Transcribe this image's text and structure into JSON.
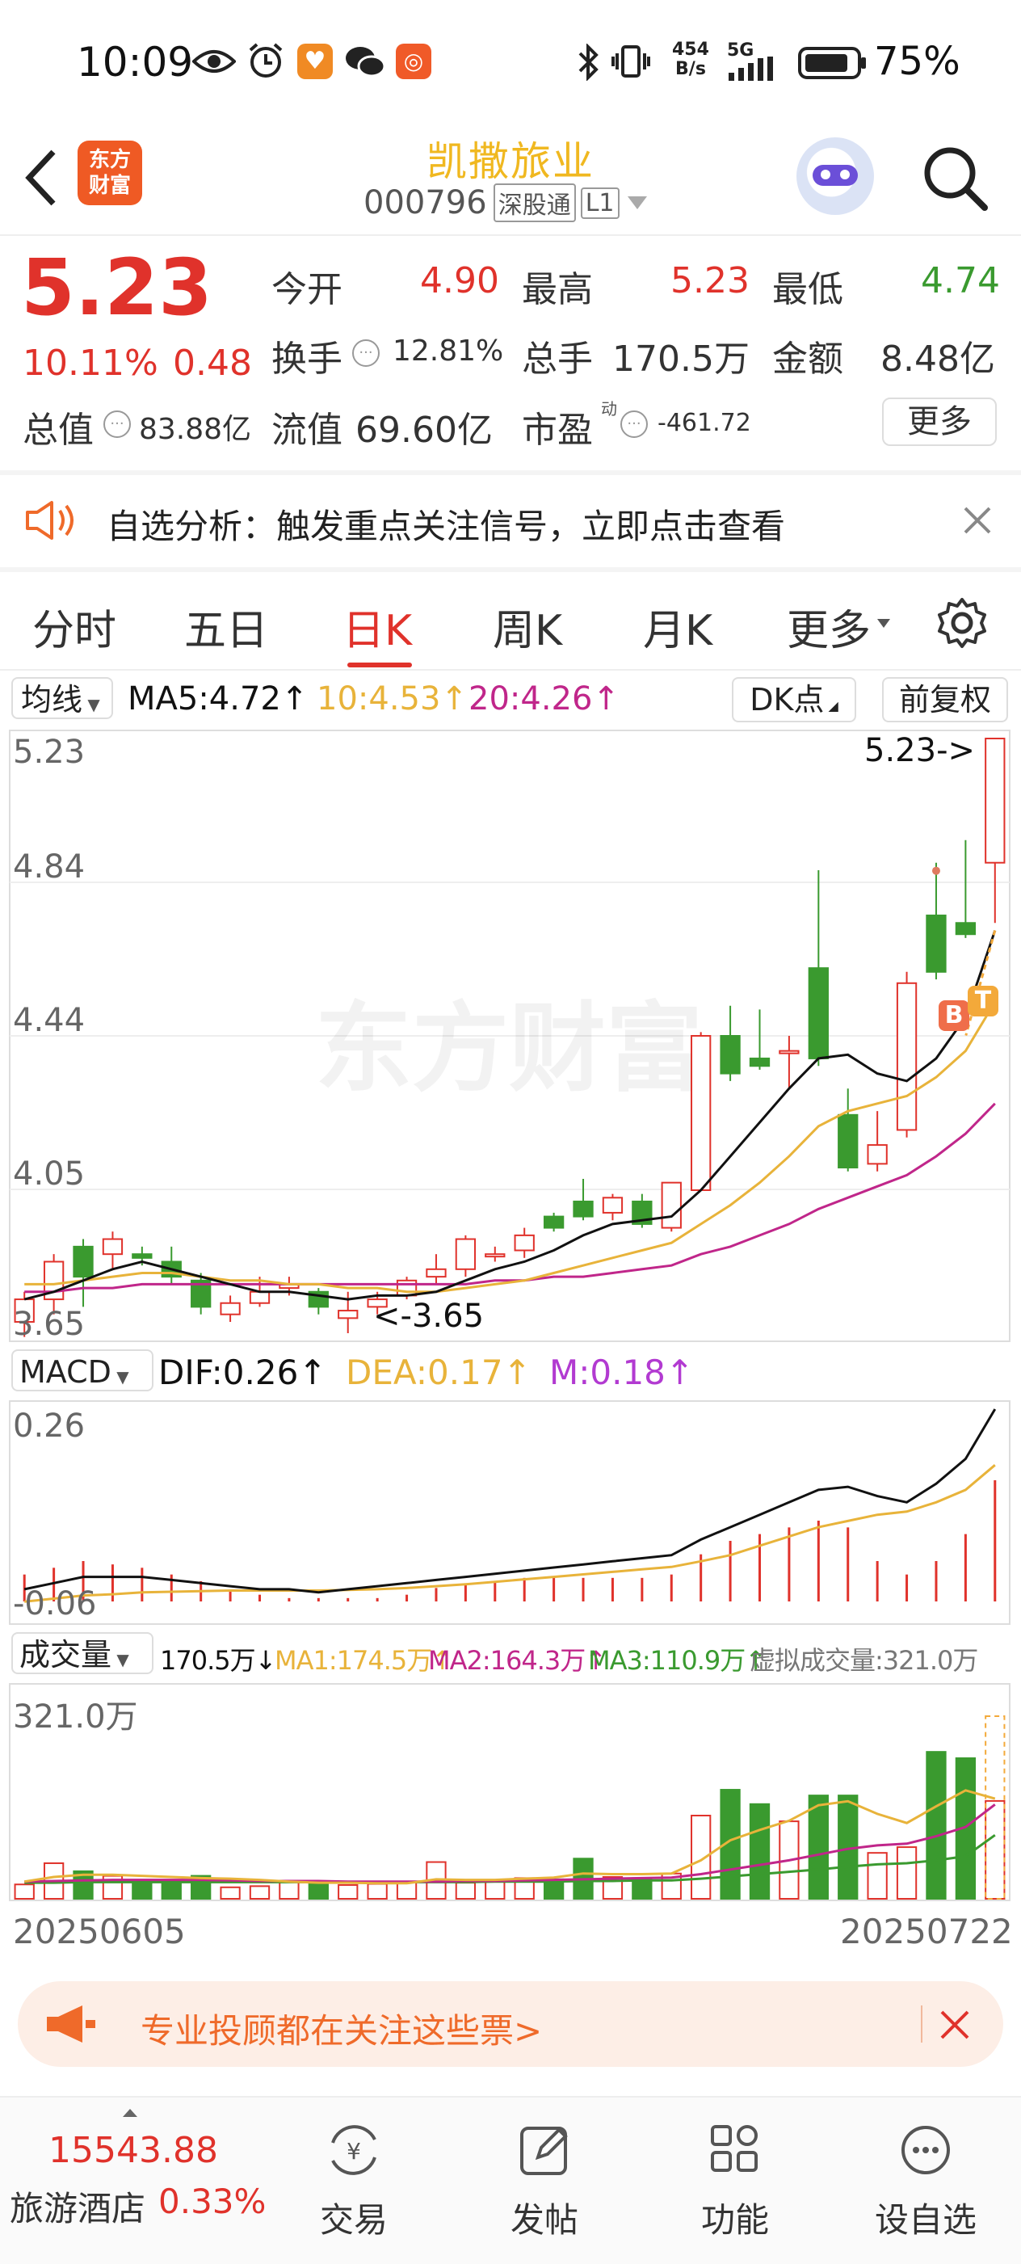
{
  "status_bar": {
    "time": "10:09",
    "net_speed_top": "454",
    "net_speed_bottom": "B/s",
    "signal": "5G",
    "battery": "75%"
  },
  "header": {
    "back_icon": "chevron-left-icon",
    "logo_line1": "东方",
    "logo_line2": "财富",
    "stock_name": "凯撒旅业",
    "stock_code": "000796",
    "tag_connect": "深股通",
    "tag_level": "L1",
    "search_icon": "search-icon"
  },
  "quote": {
    "price": "5.23",
    "change_pct": "10.11%",
    "change_amt": "0.48",
    "open_label": "今开",
    "open": "4.90",
    "high_label": "最高",
    "high": "5.23",
    "low_label": "最低",
    "low": "4.74",
    "turnover_label": "换手",
    "turnover": "12.81%",
    "volume_label": "总手",
    "volume": "170.5万",
    "amount_label": "金额",
    "amount": "8.48亿",
    "mktcap_label": "总值",
    "mktcap": "83.88亿",
    "float_label": "流值",
    "float": "69.60亿",
    "pe_label": "市盈",
    "pe_sup": "动",
    "pe": "-461.72",
    "more_button": "更多"
  },
  "notice": {
    "text": "自选分析：触发重点关注信号，立即点击查看"
  },
  "tabs": [
    {
      "label": "分时",
      "active": false
    },
    {
      "label": "五日",
      "active": false
    },
    {
      "label": "日K",
      "active": true
    },
    {
      "label": "周K",
      "active": false
    },
    {
      "label": "月K",
      "active": false
    },
    {
      "label": "更多",
      "active": false
    }
  ],
  "ma_bar": {
    "selector": "均线",
    "ma5": "MA5:4.72↑",
    "ma10": "10:4.53↑",
    "ma20": "20:4.26↑",
    "dk_button": "DK点",
    "adjust_button": "前复权"
  },
  "kline_axis": {
    "y_labels": [
      "5.23",
      "4.84",
      "4.44",
      "4.05",
      "3.65"
    ],
    "max_marker": "5.23->",
    "min_marker": "<-3.65",
    "watermark": "东方财富",
    "badge_b": "B",
    "badge_t": "T"
  },
  "macd_bar": {
    "selector": "MACD",
    "dif": "DIF:0.26↑",
    "dea": "DEA:0.17↑",
    "m": "M:0.18↑",
    "y_top": "0.26",
    "y_bottom": "-0.06"
  },
  "vol_bar": {
    "selector": "成交量",
    "vol": "170.5万↓",
    "ma1": "MA1:174.5万↑",
    "ma2": "MA2:164.3万↑",
    "ma3": "MA3:110.9万↑",
    "virtual": "虚拟成交量:321.0万",
    "y_top": "321.0万"
  },
  "date_axis": {
    "start": "20250605",
    "end": "20250722"
  },
  "promo": {
    "text": "专业投顾都在关注这些票>"
  },
  "bottom_bar": {
    "index_value": "15543.88",
    "index_name": "旅游酒店",
    "index_change": "0.33%",
    "buttons": [
      "交易",
      "发帖",
      "功能",
      "设自选"
    ]
  },
  "colors": {
    "up": "#e0322b",
    "down": "#3a9a2f",
    "ma5": "#111111",
    "ma10": "#e8b33a",
    "ma20": "#c0268a"
  },
  "chart_data": {
    "type": "candlestick",
    "ylim": [
      3.65,
      5.23
    ],
    "candles": [
      {
        "o": 3.68,
        "c": 3.74,
        "h": 3.76,
        "l": 3.64
      },
      {
        "o": 3.74,
        "c": 3.84,
        "h": 3.86,
        "l": 3.7
      },
      {
        "o": 3.88,
        "c": 3.8,
        "h": 3.9,
        "l": 3.72
      },
      {
        "o": 3.86,
        "c": 3.9,
        "h": 3.92,
        "l": 3.82
      },
      {
        "o": 3.86,
        "c": 3.85,
        "h": 3.88,
        "l": 3.83
      },
      {
        "o": 3.84,
        "c": 3.8,
        "h": 3.88,
        "l": 3.78
      },
      {
        "o": 3.79,
        "c": 3.72,
        "h": 3.81,
        "l": 3.7
      },
      {
        "o": 3.7,
        "c": 3.73,
        "h": 3.75,
        "l": 3.68
      },
      {
        "o": 3.73,
        "c": 3.76,
        "h": 3.8,
        "l": 3.72
      },
      {
        "o": 3.77,
        "c": 3.78,
        "h": 3.8,
        "l": 3.75
      },
      {
        "o": 3.76,
        "c": 3.72,
        "h": 3.77,
        "l": 3.7
      },
      {
        "o": 3.69,
        "c": 3.71,
        "h": 3.76,
        "l": 3.65
      },
      {
        "o": 3.72,
        "c": 3.74,
        "h": 3.76,
        "l": 3.7
      },
      {
        "o": 3.75,
        "c": 3.79,
        "h": 3.8,
        "l": 3.74
      },
      {
        "o": 3.8,
        "c": 3.82,
        "h": 3.86,
        "l": 3.78
      },
      {
        "o": 3.82,
        "c": 3.9,
        "h": 3.91,
        "l": 3.8
      },
      {
        "o": 3.86,
        "c": 3.86,
        "h": 3.88,
        "l": 3.84
      },
      {
        "o": 3.87,
        "c": 3.91,
        "h": 3.93,
        "l": 3.85
      },
      {
        "o": 3.96,
        "c": 3.93,
        "h": 3.97,
        "l": 3.92
      },
      {
        "o": 4.0,
        "c": 3.96,
        "h": 4.06,
        "l": 3.95
      },
      {
        "o": 3.97,
        "c": 4.01,
        "h": 4.02,
        "l": 3.95
      },
      {
        "o": 4.0,
        "c": 3.94,
        "h": 4.02,
        "l": 3.93
      },
      {
        "o": 3.93,
        "c": 4.05,
        "h": 4.05,
        "l": 3.92
      },
      {
        "o": 4.03,
        "c": 4.44,
        "h": 4.45,
        "l": 4.03
      },
      {
        "o": 4.44,
        "c": 4.34,
        "h": 4.52,
        "l": 4.32
      },
      {
        "o": 4.38,
        "c": 4.36,
        "h": 4.51,
        "l": 4.35
      },
      {
        "o": 4.4,
        "c": 4.4,
        "h": 4.44,
        "l": 4.3
      },
      {
        "o": 4.62,
        "c": 4.38,
        "h": 4.88,
        "l": 4.36
      },
      {
        "o": 4.23,
        "c": 4.09,
        "h": 4.3,
        "l": 4.08
      },
      {
        "o": 4.1,
        "c": 4.15,
        "h": 4.24,
        "l": 4.08
      },
      {
        "o": 4.19,
        "c": 4.58,
        "h": 4.61,
        "l": 4.17
      },
      {
        "o": 4.76,
        "c": 4.61,
        "h": 4.9,
        "l": 4.59
      },
      {
        "o": 4.74,
        "c": 4.71,
        "h": 4.96,
        "l": 4.7
      },
      {
        "o": 4.9,
        "c": 5.23,
        "h": 5.23,
        "l": 4.74
      }
    ],
    "ma5": [
      3.74,
      3.76,
      3.79,
      3.82,
      3.84,
      3.82,
      3.8,
      3.78,
      3.76,
      3.76,
      3.75,
      3.74,
      3.75,
      3.75,
      3.76,
      3.79,
      3.82,
      3.84,
      3.87,
      3.91,
      3.94,
      3.95,
      3.96,
      4.03,
      4.12,
      4.21,
      4.3,
      4.38,
      4.39,
      4.34,
      4.32,
      4.38,
      4.49,
      4.72
    ],
    "ma10": [
      3.78,
      3.78,
      3.79,
      3.8,
      3.81,
      3.81,
      3.8,
      3.79,
      3.79,
      3.78,
      3.78,
      3.77,
      3.77,
      3.76,
      3.76,
      3.77,
      3.78,
      3.79,
      3.81,
      3.83,
      3.85,
      3.87,
      3.89,
      3.94,
      3.99,
      4.05,
      4.12,
      4.2,
      4.24,
      4.26,
      4.28,
      4.33,
      4.4,
      4.53
    ],
    "ma20": [
      3.76,
      3.76,
      3.77,
      3.77,
      3.78,
      3.78,
      3.78,
      3.78,
      3.78,
      3.78,
      3.78,
      3.78,
      3.78,
      3.78,
      3.78,
      3.78,
      3.79,
      3.79,
      3.8,
      3.8,
      3.81,
      3.82,
      3.83,
      3.86,
      3.88,
      3.91,
      3.94,
      3.98,
      4.01,
      4.04,
      4.07,
      4.12,
      4.18,
      4.26
    ],
    "macd": {
      "ylim": [
        -0.06,
        0.26
      ],
      "dif": [
        -0.03,
        -0.02,
        -0.01,
        -0.01,
        -0.01,
        -0.015,
        -0.02,
        -0.025,
        -0.03,
        -0.03,
        -0.035,
        -0.03,
        -0.025,
        -0.02,
        -0.015,
        -0.01,
        -0.005,
        0.0,
        0.005,
        0.01,
        0.015,
        0.02,
        0.025,
        0.05,
        0.07,
        0.09,
        0.11,
        0.13,
        0.135,
        0.12,
        0.11,
        0.14,
        0.18,
        0.26
      ],
      "dea": [
        -0.05,
        -0.045,
        -0.04,
        -0.038,
        -0.035,
        -0.034,
        -0.033,
        -0.032,
        -0.032,
        -0.032,
        -0.032,
        -0.031,
        -0.03,
        -0.028,
        -0.025,
        -0.022,
        -0.018,
        -0.014,
        -0.01,
        -0.006,
        -0.002,
        0.002,
        0.006,
        0.015,
        0.025,
        0.04,
        0.055,
        0.07,
        0.08,
        0.09,
        0.095,
        0.11,
        0.13,
        0.17
      ],
      "m": [
        0.04,
        0.05,
        0.06,
        0.055,
        0.05,
        0.04,
        0.03,
        0.015,
        0.01,
        0.005,
        0.005,
        0.005,
        0.005,
        0.01,
        0.02,
        0.025,
        0.03,
        0.035,
        0.035,
        0.035,
        0.035,
        0.035,
        0.04,
        0.07,
        0.09,
        0.1,
        0.11,
        0.12,
        0.11,
        0.06,
        0.04,
        0.06,
        0.1,
        0.18
      ]
    },
    "volume": {
      "ylim": [
        0,
        321.0
      ],
      "values": [
        25,
        62,
        48,
        40,
        28,
        26,
        40,
        20,
        22,
        30,
        28,
        24,
        26,
        30,
        64,
        28,
        30,
        36,
        34,
        70,
        38,
        36,
        44,
        145,
        190,
        165,
        135,
        180,
        180,
        80,
        90,
        256,
        245,
        170.5
      ],
      "ma1": [
        30,
        38,
        42,
        42,
        40,
        38,
        36,
        35,
        33,
        30,
        28,
        28,
        27,
        27,
        34,
        33,
        33,
        35,
        37,
        44,
        43,
        43,
        44,
        67,
        102,
        120,
        136,
        163,
        170,
        148,
        132,
        161,
        189,
        174.5
      ],
      "ma2": [
        30,
        31,
        32,
        33,
        33,
        33,
        33,
        32,
        31,
        31,
        31,
        30,
        30,
        30,
        30,
        31,
        31,
        32,
        33,
        34,
        35,
        36,
        37,
        43,
        51,
        59,
        67,
        77,
        87,
        93,
        96,
        109,
        125,
        164.3
      ],
      "ma3": [
        28,
        28,
        29,
        29,
        29,
        29,
        29,
        29,
        29,
        29,
        29,
        29,
        29,
        29,
        29,
        29,
        30,
        30,
        30,
        31,
        31,
        32,
        32,
        35,
        39,
        43,
        47,
        51,
        56,
        60,
        62,
        67,
        74,
        110.9
      ]
    }
  }
}
